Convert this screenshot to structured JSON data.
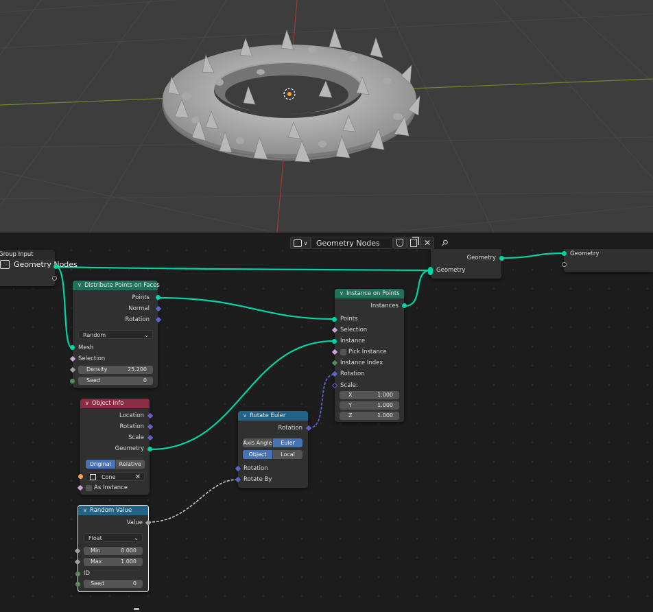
{
  "header": {
    "tree_name": "Geometry Nodes",
    "icons": [
      "editor-type-icon",
      "chevron-down-icon",
      "fake-user-shield-icon",
      "duplicate-icon",
      "close-icon",
      "pin-icon"
    ]
  },
  "nodes": {
    "group_input": {
      "title": "Group Input",
      "partial_text": "Geometry Nodes"
    },
    "distribute": {
      "title": "Distribute Points on Faces",
      "out_points": "Points",
      "out_normal": "Normal",
      "out_rotation": "Rotation",
      "mode": "Random",
      "in_mesh": "Mesh",
      "in_selection": "Selection",
      "density_label": "Density",
      "density_value": "25.200",
      "seed_label": "Seed",
      "seed_value": "0"
    },
    "object_info": {
      "title": "Object Info",
      "out_location": "Location",
      "out_rotation": "Rotation",
      "out_scale": "Scale",
      "out_geometry": "Geometry",
      "mode_original": "Original",
      "mode_relative": "Relative",
      "object": "Cone",
      "as_instance": "As Instance"
    },
    "random_value": {
      "title": "Random Value",
      "out_value": "Value",
      "type": "Float",
      "min_label": "Min",
      "min_value": "0.000",
      "max_label": "Max",
      "max_value": "1.000",
      "in_id": "ID",
      "seed_label": "Seed",
      "seed_value": "0"
    },
    "rotate_euler": {
      "title": "Rotate Euler",
      "out_rotation": "Rotation",
      "type_axis_angle": "Axis Angle",
      "type_euler": "Euler",
      "space_object": "Object",
      "space_local": "Local",
      "in_rotation": "Rotation",
      "in_rotate_by": "Rotate By"
    },
    "instance_on_points": {
      "title": "Instance on Points",
      "out_instances": "Instances",
      "in_points": "Points",
      "in_selection": "Selection",
      "in_instance": "Instance",
      "pick_instance": "Pick Instance",
      "in_instance_index": "Instance Index",
      "in_rotation": "Rotation",
      "in_scale": "Scale:",
      "x_label": "X",
      "x_value": "1.000",
      "y_label": "Y",
      "y_value": "1.000",
      "z_label": "Z",
      "z_value": "1.000"
    },
    "join_or_transform": {
      "out_geometry": "Geometry",
      "in_geometry": "Geometry"
    },
    "group_output": {
      "in_geometry": "Geometry"
    }
  },
  "colors": {
    "geometry_link": "#00d6a3",
    "vector_link": "#6363c7",
    "float_link": "#a1a1a1",
    "selected_border": "#ffffff"
  }
}
